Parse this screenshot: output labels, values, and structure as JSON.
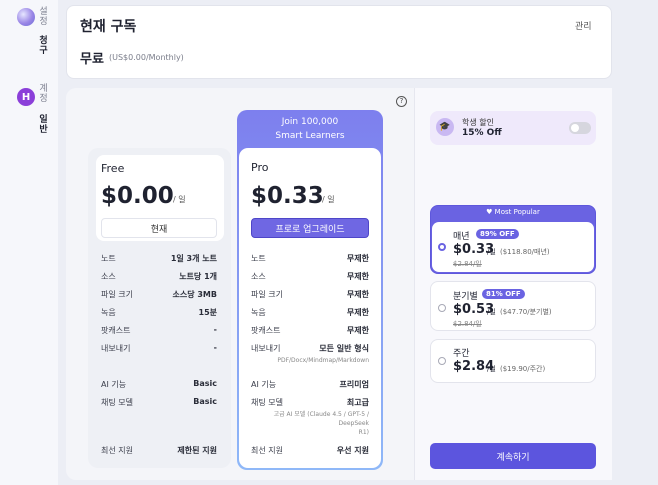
{
  "sidebar": {
    "settings_label": "설정",
    "billing_label": "청구",
    "account_label": "계정",
    "general_label": "일반",
    "avatar_initial": "H"
  },
  "subscription": {
    "title": "현재 구독",
    "manage": "관리",
    "plan": "무료",
    "price_note": "(US$0.00/Monthly)"
  },
  "free_plan": {
    "name": "Free",
    "price": "$0.00",
    "unit": "/ 일",
    "current_btn": "현재",
    "features": [
      {
        "label": "노트",
        "value": "1일 3개 노트"
      },
      {
        "label": "소스",
        "value": "노트당 1개"
      },
      {
        "label": "파일 크기",
        "value": "소스당 3MB"
      },
      {
        "label": "녹음",
        "value": "15분"
      },
      {
        "label": "팟캐스트",
        "value": "-"
      },
      {
        "label": "내보내기",
        "value": "-"
      }
    ],
    "ai_features": [
      {
        "label": "AI 기능",
        "value": "Basic"
      },
      {
        "label": "채팅 모델",
        "value": "Basic"
      }
    ],
    "support": {
      "label": "최선 지원",
      "value": "제한된 지원"
    }
  },
  "pro_plan": {
    "banner_line1": "Join 100,000",
    "banner_line2": "Smart Learners",
    "name": "Pro",
    "price": "$0.33",
    "unit": "/ 일",
    "upgrade_btn": "프로로 업그레이드",
    "features": [
      {
        "label": "노트",
        "value": "무제한"
      },
      {
        "label": "소스",
        "value": "무제한"
      },
      {
        "label": "파일 크기",
        "value": "무제한"
      },
      {
        "label": "녹음",
        "value": "무제한"
      },
      {
        "label": "팟캐스트",
        "value": "무제한"
      },
      {
        "label": "내보내기",
        "value": "모든 일반 형식"
      }
    ],
    "export_formats": "PDF/Docx/Mindmap/Markdown",
    "ai_features": [
      {
        "label": "AI 기능",
        "value": "프리미엄"
      },
      {
        "label": "채팅 모델",
        "value": "최고급"
      }
    ],
    "model_note1": "고급 AI 모델 (Claude 4.5 / GPT-5 / DeepSeek",
    "model_note2": "R1)",
    "support": {
      "label": "최선 지원",
      "value": "우선 지원"
    }
  },
  "student": {
    "label": "학생 할인",
    "discount": "15% Off",
    "enabled": false
  },
  "billing_options": {
    "popular_label": "Most Popular",
    "options": [
      {
        "name": "매년",
        "badge": "89% OFF",
        "price": "$0.33",
        "unit": "/일",
        "total": "($118.80/매년)",
        "original": "$2.84/일",
        "selected": true
      },
      {
        "name": "분기별",
        "badge": "81% OFF",
        "price": "$0.53",
        "unit": "/일",
        "total": "($47.70/분기별)",
        "original": "$2.84/일",
        "selected": false
      },
      {
        "name": "주간",
        "badge": "",
        "price": "$2.84",
        "unit": "/일",
        "total": "($19.90/주간)",
        "original": "",
        "selected": false
      }
    ],
    "continue_btn": "계속하기"
  },
  "help_icon": "question-circle-icon",
  "colors": {
    "accent": "#6a63e2",
    "pro_gradient_top": "#7d7fee",
    "pro_gradient_bottom": "#8fb8f8"
  }
}
